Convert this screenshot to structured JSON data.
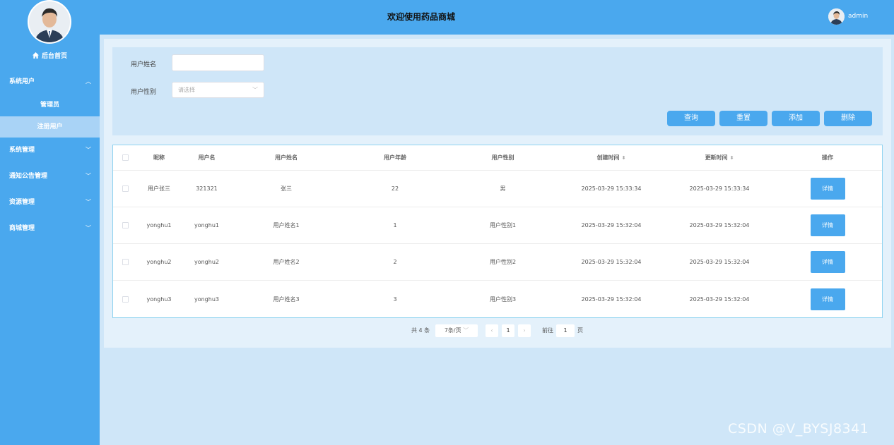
{
  "header": {
    "title": "欢迎使用药品商城",
    "username": "admin"
  },
  "sidebar": {
    "home_label": "后台首页",
    "menus": [
      {
        "label": "系统用户",
        "expanded": true,
        "children": [
          {
            "label": "管理员",
            "active": false
          },
          {
            "label": "注册用户",
            "active": true
          }
        ]
      },
      {
        "label": "系统管理",
        "expanded": false
      },
      {
        "label": "通知公告管理",
        "expanded": false
      },
      {
        "label": "资源管理",
        "expanded": false
      },
      {
        "label": "商城管理",
        "expanded": false
      }
    ]
  },
  "search": {
    "name_label": "用户姓名",
    "name_value": "",
    "gender_label": "用户性别",
    "gender_placeholder": "请选择",
    "buttons": {
      "query": "查询",
      "reset": "重置",
      "add": "添加",
      "delete": "删除"
    }
  },
  "table": {
    "headers": [
      "昵称",
      "用户名",
      "用户姓名",
      "用户年龄",
      "用户性别",
      "创建时间",
      "更新时间",
      "操作"
    ],
    "rows": [
      [
        "用户张三",
        "321321",
        "张三",
        "22",
        "男",
        "2025-03-29 15:33:34",
        "2025-03-29 15:33:34"
      ],
      [
        "yonghu1",
        "yonghu1",
        "用户姓名1",
        "1",
        "用户性别1",
        "2025-03-29 15:32:04",
        "2025-03-29 15:32:04"
      ],
      [
        "yonghu2",
        "yonghu2",
        "用户姓名2",
        "2",
        "用户性别2",
        "2025-03-29 15:32:04",
        "2025-03-29 15:32:04"
      ],
      [
        "yonghu3",
        "yonghu3",
        "用户姓名3",
        "3",
        "用户性别3",
        "2025-03-29 15:32:04",
        "2025-03-29 15:32:04"
      ]
    ],
    "detail_label": "详情"
  },
  "pagination": {
    "total": "共 4 条",
    "page_size": "7条/页",
    "current_page": "1",
    "goto_label": "前往",
    "goto_value": "1",
    "page_suffix": "页"
  },
  "watermark": "CSDN @V_BYSJ8341",
  "colors": {
    "primary": "#4aa8ee",
    "background": "#cfe6f8"
  }
}
